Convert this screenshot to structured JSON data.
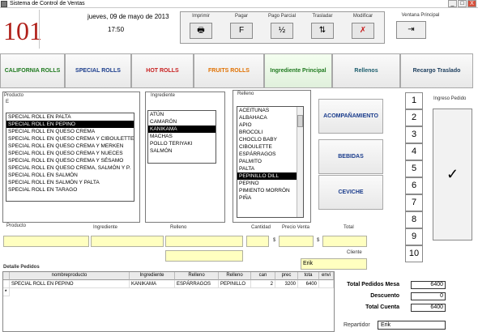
{
  "window": {
    "title": "Sistema de Control de Ventas",
    "min": "_",
    "max": "□",
    "close": "X"
  },
  "header": {
    "table_number": "101",
    "date": "jueves, 09 de mayo de 2013",
    "time": "17:50"
  },
  "toolbar": [
    {
      "label": "Imprimir",
      "glyph": "🖶"
    },
    {
      "label": "Pagar",
      "glyph": "F"
    },
    {
      "label": "Pago Parcial",
      "glyph": "½"
    },
    {
      "label": "Trasladar",
      "glyph": "⇅"
    },
    {
      "label": "Modificar",
      "glyph": "✗"
    }
  ],
  "ventana": {
    "label": "Ventana Principal",
    "glyph": "⇥"
  },
  "categories": [
    {
      "label": "CALIFORNIA ROLLS",
      "color": "#1f7a1f"
    },
    {
      "label": "SPECIAL ROLLS",
      "color": "#1a3c8c"
    },
    {
      "label": "HOT ROLLS",
      "color": "#c81e1e"
    },
    {
      "label": "FRUITS ROLLS",
      "color": "#e07000"
    },
    {
      "label": "Ingrediente Principal",
      "color": "#1f7a1f"
    },
    {
      "label": "Rellenos",
      "color": "#1a5c6c"
    },
    {
      "label": "Recargo Traslado",
      "color": "#1a3c5c"
    }
  ],
  "producto_panel": {
    "label": "Producto",
    "filter": "E",
    "items": [
      "SPECIAL ROLL EN PALTA",
      "SPECIAL ROLL EN PEPINO",
      "SPECIAL ROLL EN QUESO CREMA",
      "SPECIAL ROLL EN QUESO CREMA Y CIBOULETTE",
      "SPECIAL ROLL EN QUESO CREMA Y MERKEN",
      "SPECIAL ROLL EN QUESO CREMA Y NUECES",
      "SPECIAL ROLL EN QUESO CREMA Y SÉSAMO",
      "SPECIAL ROLL EN QUESO CREMA, SALMÓN Y P.",
      "SPECIAL ROLL EN SALMÓN",
      "SPECIAL ROLL EN SALMÓN Y PALTA",
      "SPECIAL ROLL EN TARAGO"
    ],
    "selected_index": 1
  },
  "ingrediente_panel": {
    "label": "Ingrediente",
    "items": [
      "ATÚN",
      "CAMARÓN",
      "KANIKAMA",
      "MACHAS",
      "POLLO TERIYAKI",
      "SALMÓN"
    ],
    "selected_index": 2
  },
  "relleno_panel": {
    "label": "Relleno",
    "items": [
      "ACEITUNAS",
      "ALBAHACA",
      "APIO",
      "BROCOLI",
      "CHOCLO BABY",
      "CIBOULETTE",
      "ESPÁRRAGOS",
      "PALMITO",
      "PALTA",
      "PEPINILLO DILL",
      "PEPINO",
      "PIMIENTO MORRÓN",
      "PIÑA"
    ],
    "selected_index": 9
  },
  "actions": [
    "ACOMPAÑAMIENTO",
    "BEBIDAS",
    "CEVICHE"
  ],
  "quantity_buttons": [
    "1",
    "2",
    "3",
    "4",
    "5",
    "6",
    "7",
    "8",
    "9",
    "10"
  ],
  "ingreso": {
    "label": "Ingreso Pedido",
    "glyph": "✓"
  },
  "order_form": {
    "producto_label": "Producto",
    "ingrediente_label": "Ingrediente",
    "relleno_label": "Relleno",
    "cantidad_label": "Cantidad",
    "precio_label": "Precio Venta",
    "total_label": "Total",
    "currency": "$",
    "cliente_label": "Cliente",
    "cliente_value": "Erik"
  },
  "detalle": {
    "title": "Detalle Pedidos",
    "columns": [
      "nombreproducto",
      "Ingrediente",
      "Relleno",
      "Relleno",
      "can",
      "prec",
      "tota",
      "envi"
    ],
    "rows": [
      [
        "SPECIAL ROLL EN PEPINO",
        "KANIKAMA",
        "ESPÁRRAGOS",
        "PEPINILLO",
        "2",
        "3200",
        "6400",
        ""
      ]
    ],
    "new_row_marker": "*"
  },
  "totals": {
    "mesa_label": "Total Pedidos Mesa",
    "mesa_value": "6400",
    "descuento_label": "Descuento",
    "descuento_value": "0",
    "cuenta_label": "Total Cuenta",
    "cuenta_value": "6400",
    "repartidor_label": "Repartidor",
    "repartidor_value": "Erik"
  }
}
